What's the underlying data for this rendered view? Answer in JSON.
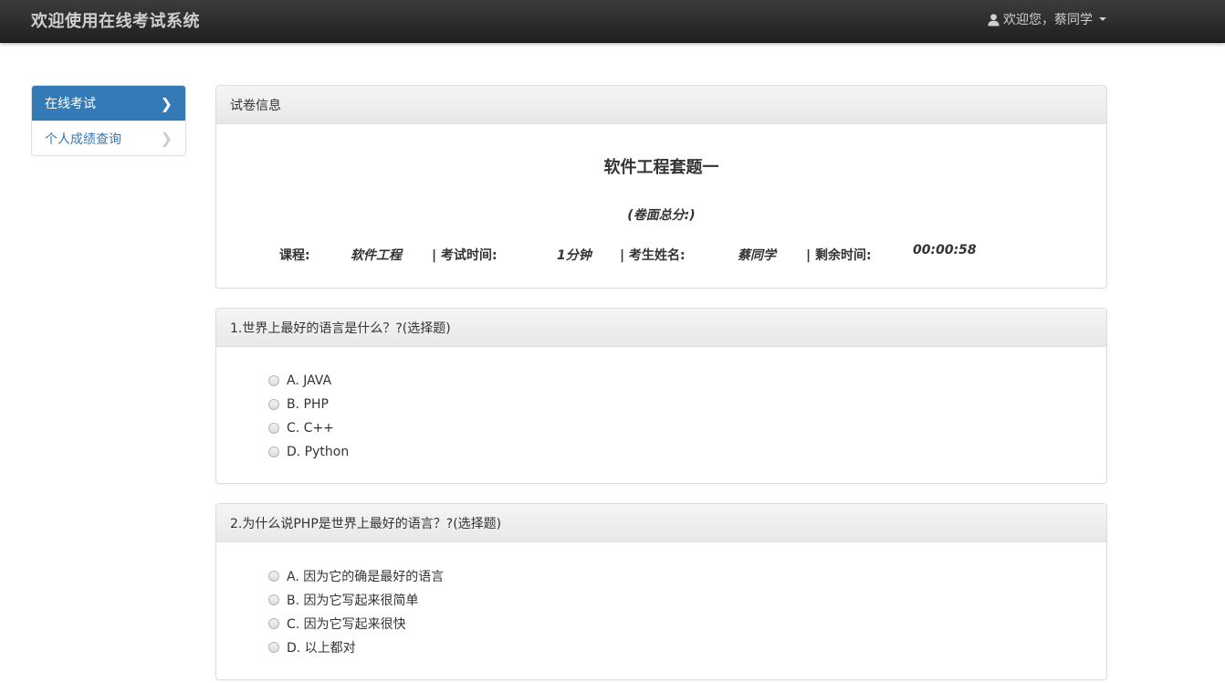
{
  "navbar": {
    "brand": "欢迎使用在线考试系统",
    "user_greeting": "欢迎您，蔡同学"
  },
  "sidebar": {
    "items": [
      {
        "label": "在线考试",
        "active": true
      },
      {
        "label": "个人成绩查询",
        "active": false
      }
    ]
  },
  "paper": {
    "heading": "试卷信息",
    "title": "软件工程套题一",
    "score_note": "(卷面总分:)",
    "course_label": "课程:",
    "course_value": "软件工程",
    "time_label": "| 考试时间:",
    "time_value": "1分钟",
    "name_label": "| 考生姓名:",
    "name_value": "蔡同学",
    "remaining_label": "| 剩余时间:",
    "remaining_value": "00:00:58"
  },
  "questions": [
    {
      "heading": "1.世界上最好的语言是什么？?(选择题)",
      "options": [
        "A. JAVA",
        "B. PHP",
        "C. C++",
        "D. Python"
      ]
    },
    {
      "heading": "2.为什么说PHP是世界上最好的语言？?(选择题)",
      "options": [
        "A. 因为它的确是最好的语言",
        "B. 因为它写起来很简单",
        "C. 因为它写起来很快",
        "D. 以上都对"
      ]
    }
  ],
  "colors": {
    "navbar_bg": "#2b2b2b",
    "accent": "#337ab7",
    "panel_heading_bg": "#f5f5f5"
  }
}
